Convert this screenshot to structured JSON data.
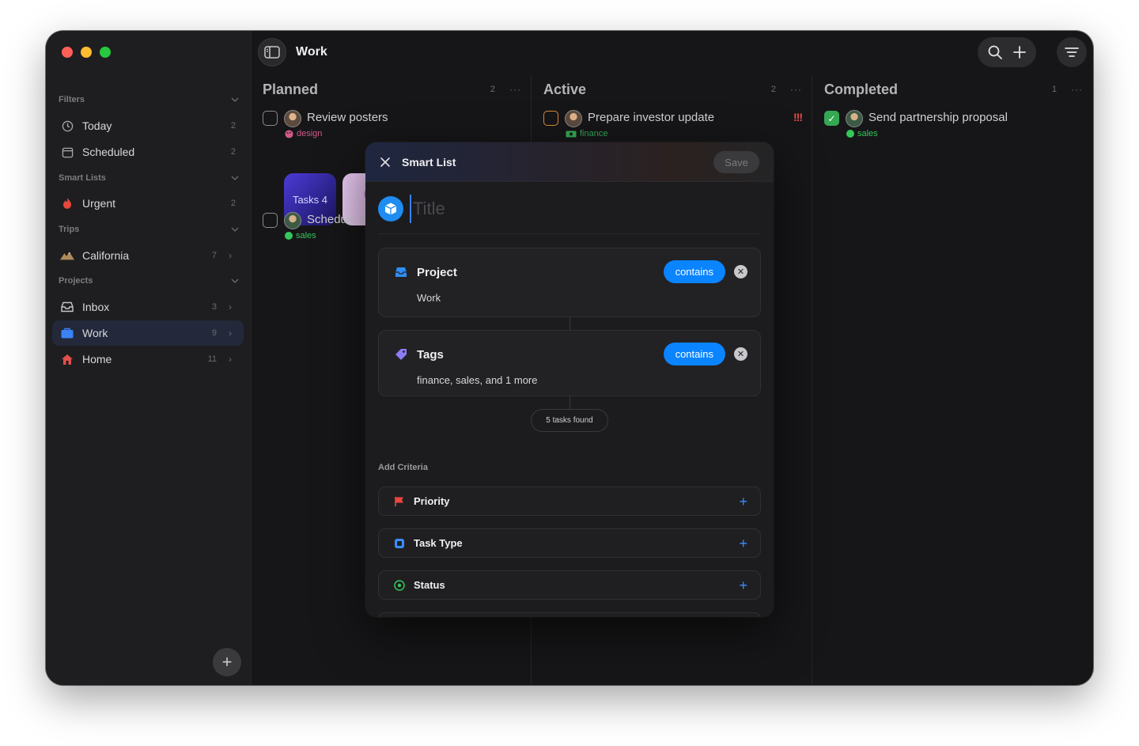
{
  "window": {
    "title": "Work"
  },
  "sidebar": {
    "sections": [
      {
        "label": "Filters"
      },
      {
        "label": "Smart Lists"
      },
      {
        "label": "Trips"
      },
      {
        "label": "Projects"
      }
    ],
    "items": [
      {
        "label": "Today",
        "count": "2",
        "icon": "clock-icon"
      },
      {
        "label": "Scheduled",
        "count": "2",
        "icon": "calendar-icon"
      },
      {
        "label": "Urgent",
        "count": "2",
        "icon": "flame-icon"
      },
      {
        "label": "California",
        "count": "7",
        "icon": "mountain-icon"
      },
      {
        "label": "Inbox",
        "count": "3",
        "icon": "inbox-icon"
      },
      {
        "label": "Work",
        "count": "9",
        "icon": "briefcase-icon"
      },
      {
        "label": "Home",
        "count": "11",
        "icon": "house-icon"
      }
    ]
  },
  "columns": [
    {
      "title": "Planned",
      "count": "2",
      "more": "···",
      "tasks": [
        {
          "title": "Review posters",
          "tag": "design",
          "tag_color": "#d05a8a"
        },
        {
          "title": "Schedule c",
          "tag": "sales",
          "tag_color": "#34c759"
        }
      ],
      "thumb_label": "Tasks 4"
    },
    {
      "title": "Active",
      "count": "2",
      "more": "···",
      "tasks": [
        {
          "title": "Prepare investor update",
          "tag": "finance",
          "tag_color": "#34a853",
          "priority": "!!!"
        }
      ]
    },
    {
      "title": "Completed",
      "count": "1",
      "more": "···",
      "tasks": [
        {
          "title": "Send partnership proposal",
          "tag": "sales",
          "tag_color": "#34c759"
        }
      ]
    }
  ],
  "modal": {
    "title": "Smart List",
    "save_label": "Save",
    "title_placeholder": "Title",
    "criteria": [
      {
        "title": "Project",
        "operator": "contains",
        "value": "Work"
      },
      {
        "title": "Tags",
        "operator": "contains",
        "value": "finance, sales, and 1 more"
      }
    ],
    "tasks_found": "5 tasks found",
    "add_criteria_label": "Add Criteria",
    "add_options": [
      {
        "label": "Priority",
        "icon": "flag-icon"
      },
      {
        "label": "Task Type",
        "icon": "square-icon"
      },
      {
        "label": "Status",
        "icon": "status-circle-icon"
      }
    ]
  },
  "colors": {
    "accent": "#0a84ff",
    "priority": "#e84b4b",
    "done": "#34a853"
  }
}
